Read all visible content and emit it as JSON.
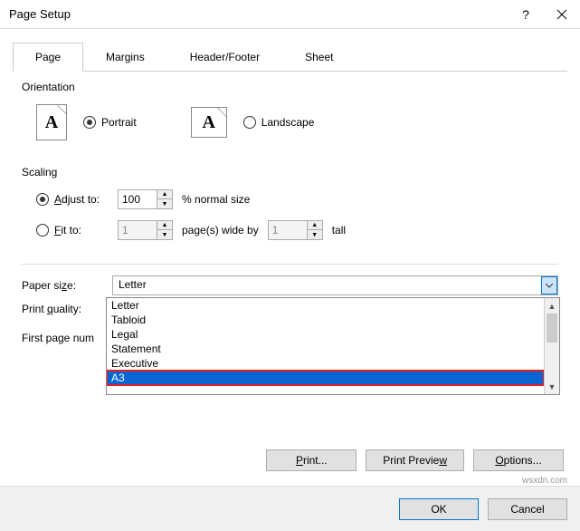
{
  "window": {
    "title": "Page Setup"
  },
  "tabs": [
    "Page",
    "Margins",
    "Header/Footer",
    "Sheet"
  ],
  "orientation": {
    "title": "Orientation",
    "portrait": "Portrait",
    "landscape": "Landscape"
  },
  "scaling": {
    "title": "Scaling",
    "adjust_label": "Adjust to:",
    "adjust_value": "100",
    "adjust_suffix": "% normal size",
    "fit_label": "Fit to:",
    "fit_wide": "1",
    "fit_mid": "page(s) wide by",
    "fit_tall_value": "1",
    "fit_tall_suffix": "tall"
  },
  "paper": {
    "label": "Paper size:",
    "value": "Letter",
    "options": [
      "Letter",
      "Tabloid",
      "Legal",
      "Statement",
      "Executive",
      "A3"
    ]
  },
  "quality": {
    "label": "Print quality:"
  },
  "firstpage": {
    "label": "First page num"
  },
  "buttons": {
    "print": "Print...",
    "preview": "Print Preview",
    "options": "Options...",
    "ok": "OK",
    "cancel": "Cancel"
  },
  "watermark": "wsxdn.com"
}
